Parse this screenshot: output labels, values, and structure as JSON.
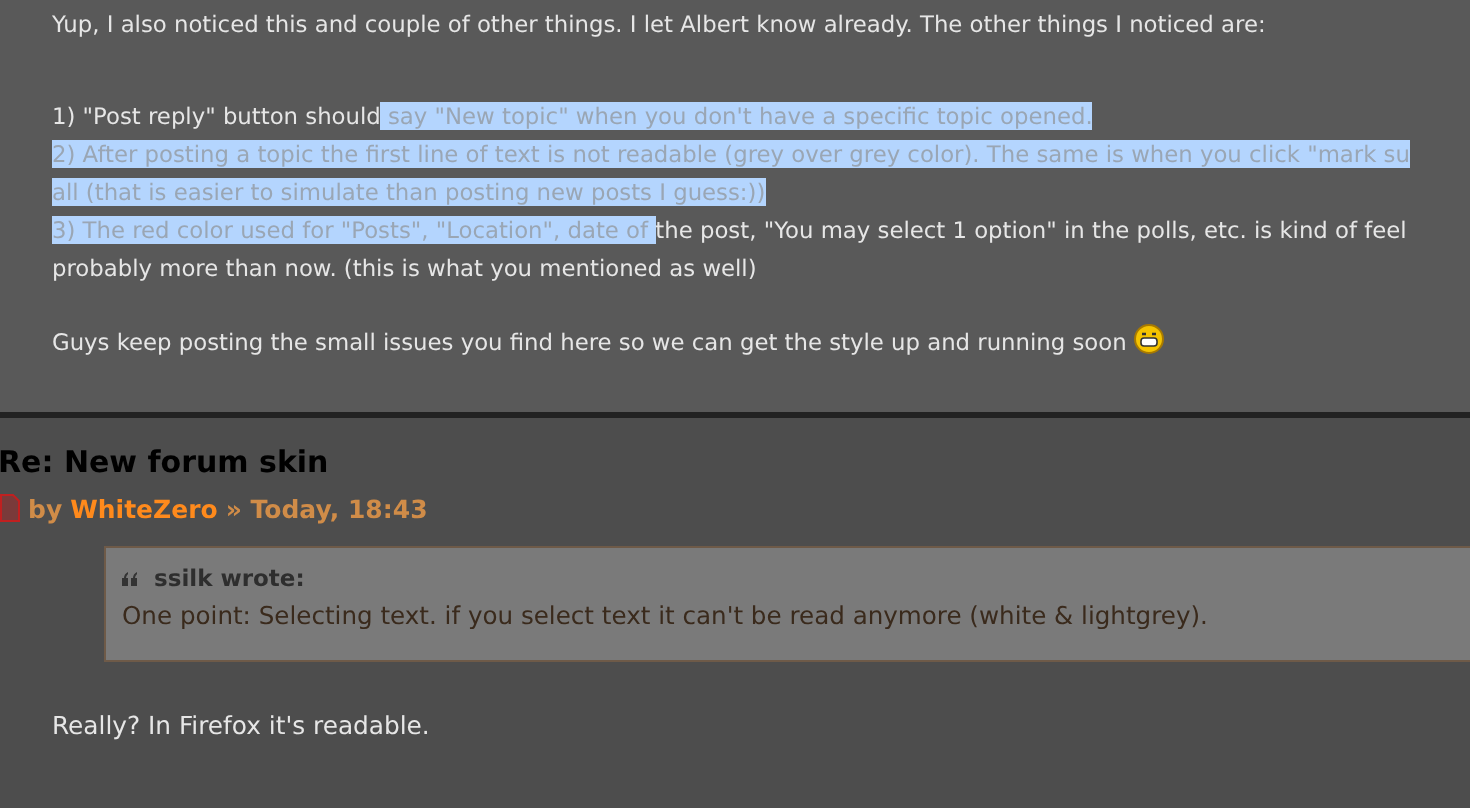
{
  "posts": [
    {
      "paragraphs": [
        [
          [
            {
              "text": "Yup, I also noticed this and couple of other things. I let Albert know already. The other things I noticed are:",
              "selected": false
            }
          ]
        ],
        [
          [
            {
              "text": "1) \"Post reply\" button should",
              "selected": false
            },
            {
              "text": " say \"New topic\" when you don't have a specific topic opened.",
              "selected": true
            }
          ],
          [
            {
              "text": "2) After posting a topic the first line of text is not readable (grey over grey color). The same is when you click \"mark su",
              "selected": true
            }
          ],
          [
            {
              "text": "all (that is easier to simulate than posting new posts I guess:))",
              "selected": true
            }
          ],
          [
            {
              "text": "3) The red color used for \"Posts\", \"Location\", date of ",
              "selected": true
            },
            {
              "text": "the post, \"You may select 1 option\" in the polls, etc. is kind of feel",
              "selected": false
            }
          ],
          [
            {
              "text": "probably more than now. (this is what you mentioned as well)",
              "selected": false
            }
          ]
        ],
        [
          [
            {
              "text": "Guys keep posting the small issues you find here so we can get the style up and running soon",
              "selected": false
            }
          ]
        ]
      ]
    },
    {
      "title": "Re: New forum skin",
      "by": "by",
      "author": "WhiteZero",
      "date": "» Today, 18:43",
      "quote": {
        "author": "ssilk wrote:",
        "text": "One point: Selecting text. if you select text it can't be read anymore (white & lightgrey)."
      },
      "body": "Really? In Firefox it's readable."
    }
  ]
}
